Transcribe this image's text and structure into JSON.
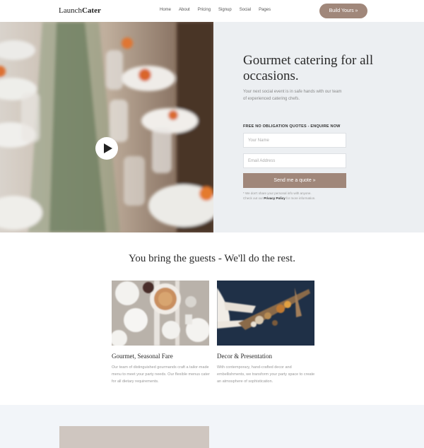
{
  "header": {
    "logo_light": "Launch",
    "logo_bold": "Cater",
    "nav": [
      "Home",
      "About",
      "Pricing",
      "Signup",
      "Social",
      "Pages"
    ],
    "cta_label": "Build Yours »"
  },
  "hero": {
    "title": "Gourmet catering for all occasions.",
    "subtitle": "Your next social event is in safe hands with our team of experienced catering chefs.",
    "form_label": "FREE NO OBLIGATION QUOTES - ENQUIRE NOW",
    "name_placeholder": "Your Name",
    "email_placeholder": "Email Address",
    "submit_label": "Send me a quote »",
    "disclaimer_pre": "* We don't share your personal info with anyone. Check out our ",
    "disclaimer_link": "Privacy Policy",
    "disclaimer_post": " for more information.",
    "play_icon": "play-icon"
  },
  "features": {
    "title": "You bring the guests - We'll do the rest.",
    "cards": [
      {
        "title": "Gourmet, Seasonal Fare",
        "text": "Our team of distinguished gourmands craft a tailor-made menu to meet your party needs. Our flexible menus cater for all dietary requirements."
      },
      {
        "title": "Decor & Presentation",
        "text": "With contemporary, hand-crafted decor and embellishments, we transform your party space to create an atmosphere of sophistication."
      }
    ]
  },
  "colors": {
    "accent": "#a0877a",
    "panel": "#eceff2",
    "band": "#f2f5f9"
  }
}
